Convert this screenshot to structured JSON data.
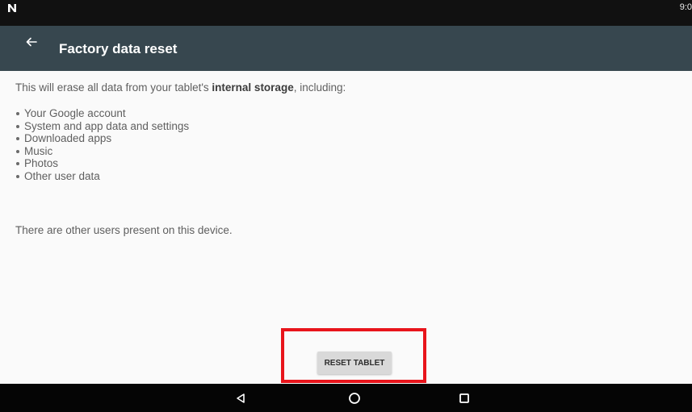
{
  "status_bar": {
    "logo_icon": "n-logo-icon",
    "time": "9:0"
  },
  "toolbar": {
    "back_icon": "arrow-back-icon",
    "title": "Factory data reset",
    "bg_color": "#37474f"
  },
  "content": {
    "intro_before": "This will erase all data from your tablet's ",
    "intro_bold": "internal storage",
    "intro_after": ", including:",
    "items": [
      "Your Google account",
      "System and app data and settings",
      "Downloaded apps",
      "Music",
      "Photos",
      "Other user data"
    ],
    "other_users_note": "There are other users present on this device."
  },
  "reset_button": {
    "label": "RESET TABLET",
    "highlight_color": "#e8141b"
  },
  "nav_bar": {
    "back_icon": "nav-back-triangle-icon",
    "home_icon": "nav-home-circle-icon",
    "recents_icon": "nav-recents-square-icon"
  }
}
